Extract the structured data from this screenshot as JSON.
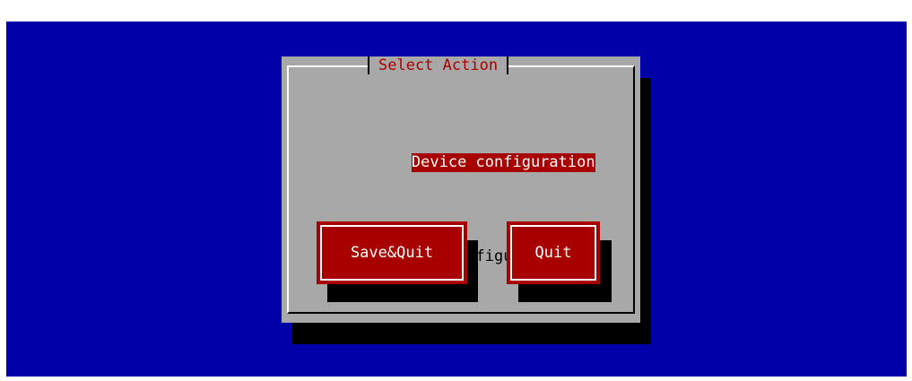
{
  "colors": {
    "desktop": "#0000a8",
    "dialog": "#a8a8a8",
    "accent": "#a80000",
    "shadow": "#000000",
    "text": "#000000",
    "highlight_text": "#ffffff"
  },
  "dialog": {
    "title": "Select Action",
    "menu_items": [
      {
        "label": "Device configuration",
        "selected": true
      },
      {
        "label": "DNS configuration",
        "selected": false
      }
    ],
    "buttons": {
      "save_quit": "Save&Quit",
      "quit": "Quit"
    }
  }
}
